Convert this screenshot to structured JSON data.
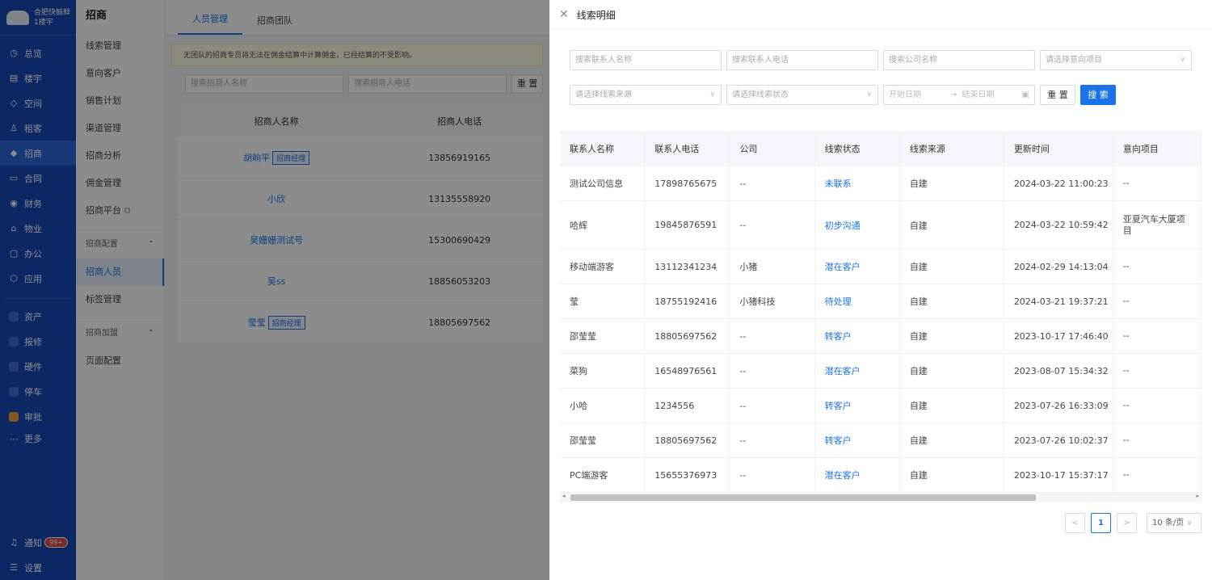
{
  "nav": {
    "brand": {
      "name": "合肥快鲸鲜",
      "building": "1楼宇"
    },
    "items": [
      {
        "label": "总览",
        "icon": "dashboard-icon"
      },
      {
        "label": "楼宇",
        "icon": "building-icon"
      },
      {
        "label": "空间",
        "icon": "space-icon"
      },
      {
        "label": "租客",
        "icon": "tenant-icon"
      },
      {
        "label": "招商",
        "icon": "investment-icon"
      },
      {
        "label": "合同",
        "icon": "contract-icon"
      },
      {
        "label": "财务",
        "icon": "finance-icon"
      },
      {
        "label": "物业",
        "icon": "property-icon"
      },
      {
        "label": "办公",
        "icon": "office-icon"
      },
      {
        "label": "应用",
        "icon": "app-icon"
      }
    ],
    "apps": [
      {
        "label": "资产"
      },
      {
        "label": "报修"
      },
      {
        "label": "硬件"
      },
      {
        "label": "停车"
      },
      {
        "label": "审批"
      },
      {
        "label": "更多"
      }
    ],
    "notify": {
      "label": "通知",
      "badge": "99+"
    },
    "settings": {
      "label": "设置"
    }
  },
  "subnav": {
    "title": "招商",
    "items": [
      "线索管理",
      "意向客户",
      "销售计划",
      "渠道管理",
      "招商分析",
      "佣金管理",
      "招商平台"
    ],
    "group1": "招商配置",
    "group1_items": [
      "招商人员",
      "标签管理"
    ],
    "group2": "招商加盟",
    "group2_items": [
      "页面配置"
    ]
  },
  "main": {
    "tabs": [
      "人员管理",
      "招商团队"
    ],
    "notice": "无团队的招商专员将无法在佣金结算中计算佣金，已经结算的不受影响。",
    "search_name": "搜索招商人名称",
    "search_phone": "搜索招商人电话",
    "reset": "重 置",
    "columns": [
      "招商人名称",
      "招商人电话"
    ],
    "rows": [
      {
        "name": "胡晌平",
        "tag": "招商经理",
        "phone": "13856919165"
      },
      {
        "name": "小欣",
        "tag": "",
        "phone": "13135558920"
      },
      {
        "name": "吴姗姗测试号",
        "tag": "",
        "phone": "15300690429"
      },
      {
        "name": "吴ss",
        "tag": "",
        "phone": "18856053203"
      },
      {
        "name": "莹莹",
        "tag": "招商经理",
        "phone": "18805697562"
      }
    ]
  },
  "drawer": {
    "title": "线索明细",
    "filters": {
      "contact_name": "搜索联系人名称",
      "contact_phone": "搜索联系人电话",
      "company": "搜索公司名称",
      "project": "请选择意向项目",
      "source": "请选择线索来源",
      "status": "请选择线索状态",
      "start_date": "开始日期",
      "end_date": "结束日期",
      "reset": "重 置",
      "search": "搜 索"
    },
    "columns": [
      "联系人名称",
      "联系人电话",
      "公司",
      "线索状态",
      "线索来源",
      "更新时间",
      "意向项目"
    ],
    "rows": [
      {
        "name": "测试公司信息",
        "phone": "17898765675",
        "company": "--",
        "status": "未联系",
        "source": "自建",
        "time": "2024-03-22 11:00:23",
        "project": "--"
      },
      {
        "name": "哈辉",
        "phone": "19845876591",
        "company": "--",
        "status": "初步沟通",
        "source": "自建",
        "time": "2024-03-22 10:59:42",
        "project": "亚夏汽车大厦项目"
      },
      {
        "name": "移动端游客",
        "phone": "13112341234",
        "company": "小猪",
        "status": "潜在客户",
        "source": "自建",
        "time": "2024-02-29 14:13:04",
        "project": "--"
      },
      {
        "name": "莹",
        "phone": "18755192416",
        "company": "小猪科技",
        "status": "待处理",
        "source": "自建",
        "time": "2024-03-21 19:37:21",
        "project": "--"
      },
      {
        "name": "邵莹莹",
        "phone": "18805697562",
        "company": "--",
        "status": "转客户",
        "source": "自建",
        "time": "2023-10-17 17:46:40",
        "project": "--"
      },
      {
        "name": "菜狗",
        "phone": "16548976561",
        "company": "--",
        "status": "潜在客户",
        "source": "自建",
        "time": "2023-08-07 15:34:32",
        "project": "--"
      },
      {
        "name": "小哈",
        "phone": "1234556",
        "company": "--",
        "status": "转客户",
        "source": "自建",
        "time": "2023-07-26 16:33:09",
        "project": "--"
      },
      {
        "name": "邵莹莹",
        "phone": "18805697562",
        "company": "--",
        "status": "转客户",
        "source": "自建",
        "time": "2023-07-26 10:02:37",
        "project": "--"
      },
      {
        "name": "PC端游客",
        "phone": "15655376973",
        "company": "--",
        "status": "潜在客户",
        "source": "自建",
        "time": "2023-10-17 15:37:17",
        "project": "--"
      }
    ],
    "pagination": {
      "current": "1",
      "page_size": "10 条/页"
    }
  },
  "colors": {
    "nav_bg": "#1449b8",
    "accent": "#1a73e8"
  }
}
